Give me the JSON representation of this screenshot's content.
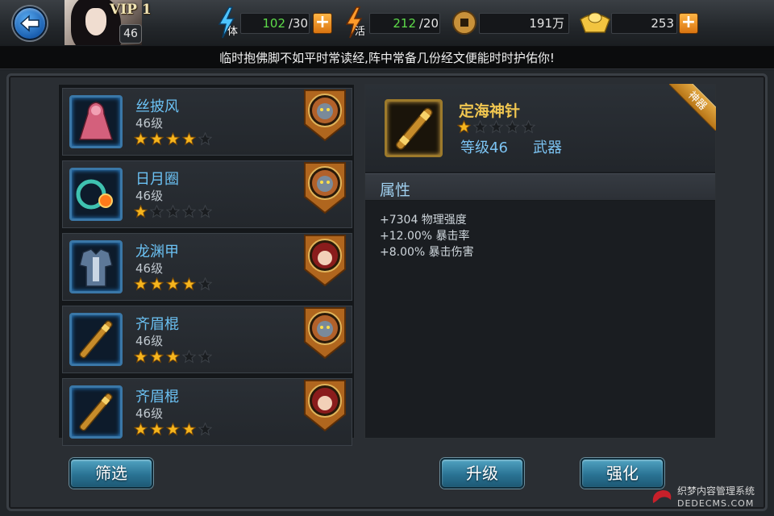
{
  "header": {
    "vip_label": "VIP 1",
    "player_level": "46",
    "stamina": {
      "tag": "体",
      "current": "102",
      "max": "/30"
    },
    "energy": {
      "tag": "活",
      "current": "212",
      "max": "/20"
    },
    "coins": "191万",
    "ingots": "253",
    "plus_label": "+"
  },
  "tip": "临时抱佛脚不如平时常读经,阵中常备几份经文便能时时护佑你!",
  "equipment_list": [
    {
      "name": "丝披风",
      "level": "46级",
      "stars": 4,
      "max_stars": 5,
      "icon": "cloak-icon",
      "owner": "monster-avatar"
    },
    {
      "name": "日月圈",
      "level": "46级",
      "stars": 1,
      "max_stars": 5,
      "icon": "ring-icon",
      "owner": "monster-avatar"
    },
    {
      "name": "龙渊甲",
      "level": "46级",
      "stars": 4,
      "max_stars": 5,
      "icon": "armor-icon",
      "owner": "girl-avatar"
    },
    {
      "name": "齐眉棍",
      "level": "46级",
      "stars": 3,
      "max_stars": 5,
      "icon": "staff-icon",
      "owner": "monster-avatar"
    },
    {
      "name": "齐眉棍",
      "level": "46级",
      "stars": 4,
      "max_stars": 5,
      "icon": "staff-icon",
      "owner": "girl-avatar"
    }
  ],
  "detail": {
    "name": "定海神针",
    "stars": 1,
    "max_stars": 5,
    "level": "等级46",
    "type": "武器",
    "ribbon": "神器",
    "attr_title": "属性",
    "attributes": [
      "+7304 物理强度",
      "+12.00% 暴击率",
      "+8.00% 暴击伤害"
    ]
  },
  "buttons": {
    "filter": "筛选",
    "upgrade": "升级",
    "enhance": "强化"
  },
  "watermark": {
    "title": "织梦内容管理系统",
    "sub": "DEDECMS.COM"
  }
}
